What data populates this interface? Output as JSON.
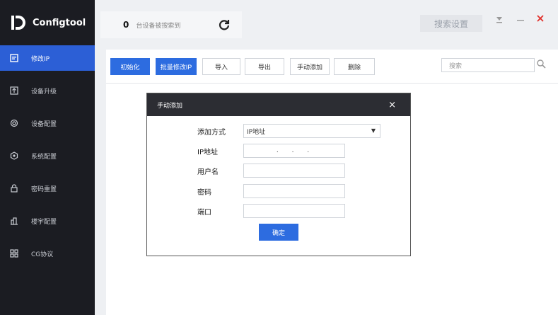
{
  "app": {
    "name": "Configtool"
  },
  "sidebar": {
    "items": [
      {
        "label": "修改IP",
        "icon": "edit-ip-icon",
        "active": true
      },
      {
        "label": "设备升级",
        "icon": "upgrade-icon"
      },
      {
        "label": "设备配置",
        "icon": "device-config-icon"
      },
      {
        "label": "系统配置",
        "icon": "system-config-icon"
      },
      {
        "label": "密码重置",
        "icon": "password-reset-icon"
      },
      {
        "label": "楼宇配置",
        "icon": "building-config-icon"
      },
      {
        "label": "CG协议",
        "icon": "protocol-grid-icon"
      }
    ]
  },
  "header": {
    "device_count": "0",
    "device_count_label": "台设备被搜索到",
    "search_settings": "搜索设置"
  },
  "toolbar": {
    "init": "初始化",
    "batch_modify_ip": "批量修改IP",
    "import": "导入",
    "export": "导出",
    "manual_add": "手动添加",
    "delete": "删除",
    "search_placeholder": "搜索"
  },
  "dialog": {
    "title": "手动添加",
    "add_method_label": "添加方式",
    "add_method_value": "IP地址",
    "ip_label": "IP地址",
    "ip_dots": ".    .    .",
    "username_label": "用户名",
    "password_label": "密码",
    "port_label": "端口",
    "confirm": "确定"
  },
  "colors": {
    "accent": "#2d6ce0",
    "sidebar_bg": "#1b1c22",
    "active_bg": "#2c5fd6",
    "close_red": "#e0302b"
  }
}
